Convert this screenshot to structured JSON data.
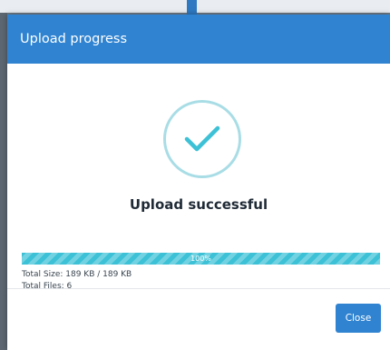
{
  "dialog": {
    "title": "Upload progress"
  },
  "status": {
    "icon": "check-circle-icon",
    "message": "Upload successful"
  },
  "progress": {
    "percent": 100,
    "label": "100%"
  },
  "details": {
    "total_size": "Total Size: 189 KB / 189 KB",
    "total_files": "Total Files: 6"
  },
  "footer": {
    "close_label": "Close"
  },
  "colors": {
    "header": "#2f83d1",
    "progress_fill": "#3cc1d6",
    "check": "#3cc1d6",
    "circle_border": "#a9dde6",
    "button": "#2f83d1"
  }
}
